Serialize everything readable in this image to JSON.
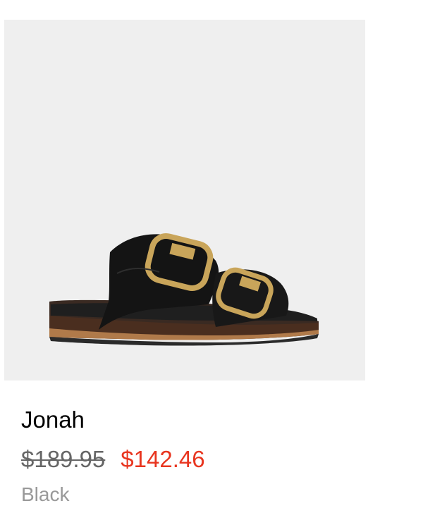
{
  "product": {
    "name": "Jonah",
    "original_price": "$189.95",
    "sale_price": "$142.46",
    "color_name": "Black",
    "image_background": "#efefef"
  },
  "colors": {
    "sale_price": "#e8351f",
    "original_price": "#666666",
    "color_label": "#999999",
    "name": "#000000"
  },
  "icons": {
    "product_image": "double-buckle-slide-sandal"
  }
}
